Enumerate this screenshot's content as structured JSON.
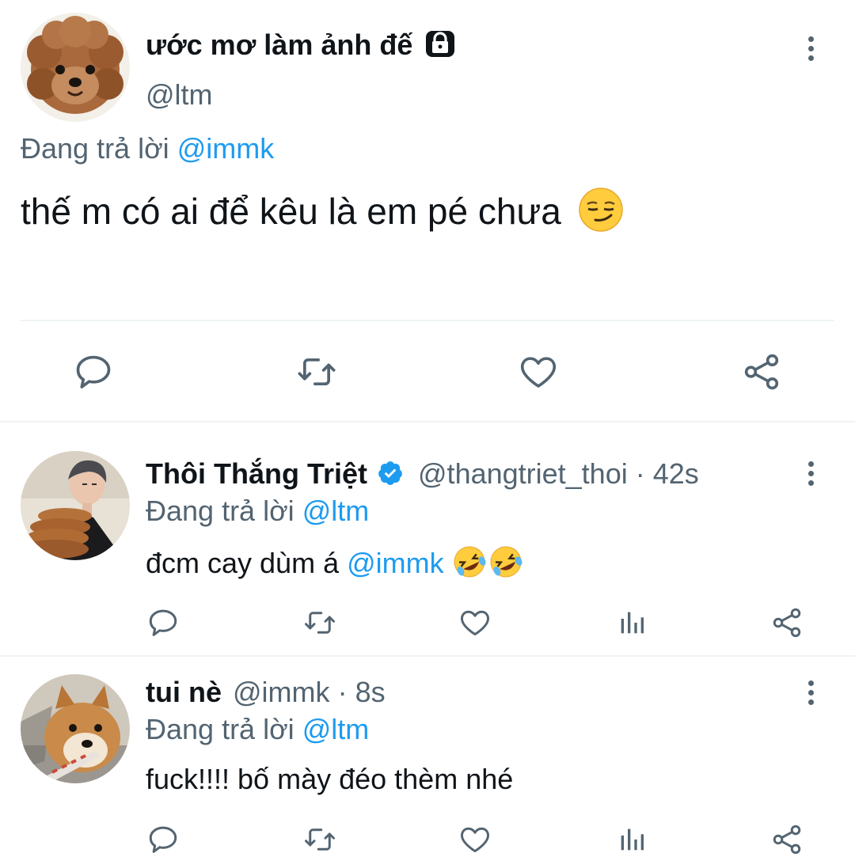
{
  "main_tweet": {
    "display_name": "ước mơ làm ảnh đế",
    "handle": "@ltm",
    "replying_prefix": "Đang trả lời",
    "replying_to": "@immk",
    "text": "thế m có ai để kêu là em pé chưa",
    "icons": {
      "lock": "lock-icon",
      "more": "more-vertical-icon",
      "emoji": "smirking-face-emoji",
      "actions": [
        "reply-icon",
        "retweet-icon",
        "like-icon",
        "share-icon"
      ]
    }
  },
  "replies": [
    {
      "display_name": "Thôi Thắng Triệt",
      "verified": true,
      "handle": "@thangtriet_thoi",
      "separator": "·",
      "time": "42s",
      "replying_prefix": "Đang trả lời",
      "replying_to": "@ltm",
      "text_before": "đcm cay dùm á",
      "mention": "@immk",
      "emoji": "rolling-on-floor-laughing-emoji ×2"
    },
    {
      "display_name": "tui nè",
      "handle": "@immk",
      "separator": "·",
      "time": "8s",
      "replying_prefix": "Đang trả lời",
      "replying_to": "@ltm",
      "text": "fuck!!!! bố mày đéo thèm nhé"
    }
  ],
  "colors": {
    "accent": "#1d9bf0",
    "text": "#0f1419",
    "muted": "#536471",
    "divider": "#eff3f4",
    "verified": "#1d9bf0"
  }
}
